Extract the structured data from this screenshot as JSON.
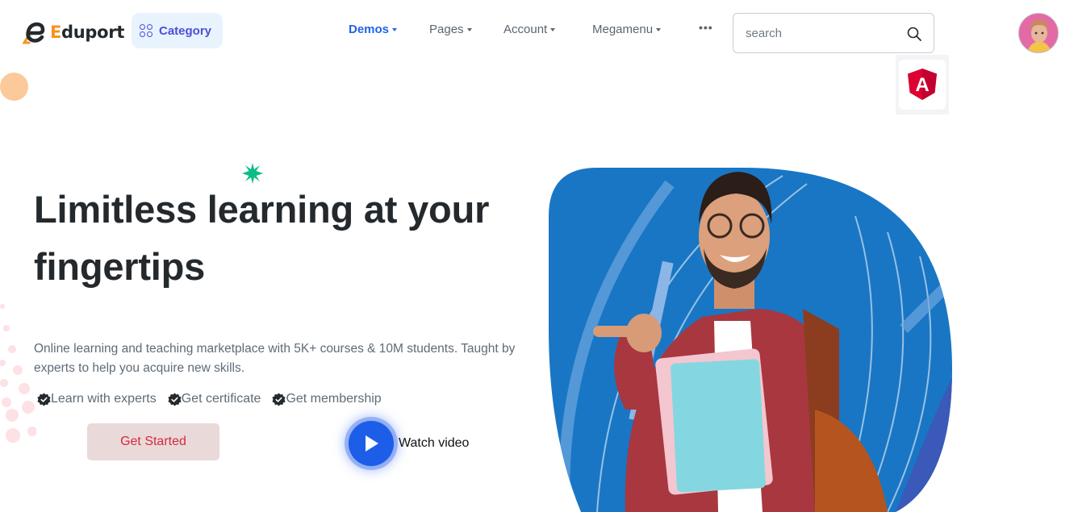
{
  "header": {
    "brand": {
      "initial": "E",
      "rest": "duport",
      "initial_color": "#f7931e"
    },
    "category_button": {
      "label": "Category",
      "icon": "grid-circles-icon"
    },
    "nav": [
      {
        "label": "Demos",
        "active": true,
        "has_caret": true
      },
      {
        "label": "Pages",
        "active": false,
        "has_caret": true
      },
      {
        "label": "Account",
        "active": false,
        "has_caret": true
      },
      {
        "label": "Megamenu",
        "active": false,
        "has_caret": true
      },
      {
        "label": "•••",
        "active": false,
        "has_caret": false
      }
    ],
    "search": {
      "placeholder": "search",
      "value": "",
      "icon": "search-icon"
    },
    "avatar": {
      "icon": "user-avatar"
    },
    "framework_badge": {
      "icon": "angular-icon",
      "letter": "A"
    }
  },
  "hero": {
    "title_line1": "Limitless learning at your",
    "title_line2": "fingertips",
    "description": "Online learning and teaching marketplace with 5K+ courses & 10M students. Taught by experts to help you acquire new skills.",
    "features": [
      {
        "label": "Learn with experts",
        "icon": "verified-check-icon"
      },
      {
        "label": "Get certificate",
        "icon": "verified-check-icon"
      },
      {
        "label": "Get membership",
        "icon": "verified-check-icon"
      }
    ],
    "cta_label": "Get Started",
    "video_label": "Watch video"
  },
  "colors": {
    "primary": "#2163e8",
    "accent_orange": "#f7931e",
    "cta_text": "#d6293e",
    "cta_bg": "#ead9d9",
    "hero_blob": "#1976c4"
  }
}
